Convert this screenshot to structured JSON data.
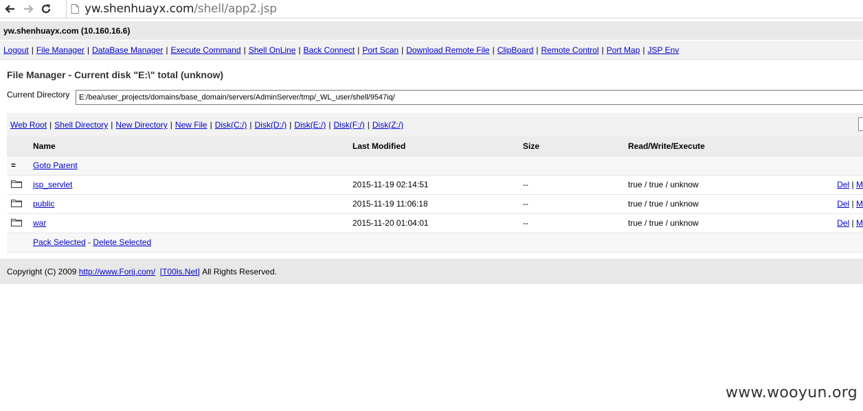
{
  "browser": {
    "url_host": "yw.shenhuayx.com",
    "url_path": "/shell/app2.jsp"
  },
  "header": {
    "host": "yw.shenhuayx.com (10.160.16.6)"
  },
  "menu": [
    "Logout",
    "File Manager",
    "DataBase Manager",
    "Execute Command",
    "Shell OnLine",
    "Back Connect",
    "Port Scan",
    "Download Remote File",
    "ClipBoard",
    "Remote Control",
    "Port Map",
    "JSP Env"
  ],
  "file_manager": {
    "title": "File Manager - Current disk \"E:\\\" total (unknow)",
    "current_dir_label": "Current Directory",
    "current_dir_value": "E:/bea/user_projects/domains/base_domain/servers/AdminServer/tmp/_WL_user/shell/9547iq/",
    "quick_links": [
      "Web Root",
      "Shell Directory",
      "New Directory",
      "New File",
      "Disk(C:/)",
      "Disk(D:/)",
      "Disk(E:/)",
      "Disk(F:/)",
      "Disk(Z:/)"
    ],
    "columns": {
      "name": "Name",
      "modified": "Last Modified",
      "size": "Size",
      "rwx": "Read/Write/Execute"
    },
    "parent_icon": "=",
    "parent_link": "Goto Parent",
    "rows": [
      {
        "icon": "folder-icon",
        "name": "jsp_servlet",
        "modified": "2015-11-19 02:14:51",
        "size": "--",
        "rwx": "true / true / unknow",
        "del": "Del",
        "more": "M"
      },
      {
        "icon": "folder-icon",
        "name": "public",
        "modified": "2015-11-19 11:06:18",
        "size": "--",
        "rwx": "true / true / unknow",
        "del": "Del",
        "more": "M"
      },
      {
        "icon": "folder-icon",
        "name": "war",
        "modified": "2015-11-20 01:04:01",
        "size": "--",
        "rwx": "true / true / unknow",
        "del": "Del",
        "more": "M"
      }
    ],
    "pack_selected": "Pack Selected",
    "action_sep": "-",
    "delete_selected": "Delete Selected"
  },
  "footer": {
    "copyright": "Copyright (C) 2009",
    "link1": "http://www.Forjj.com/",
    "link2": "[T00ls.Net]",
    "rights": "All Rights Reserved."
  },
  "watermark": "www.wooyun.org"
}
